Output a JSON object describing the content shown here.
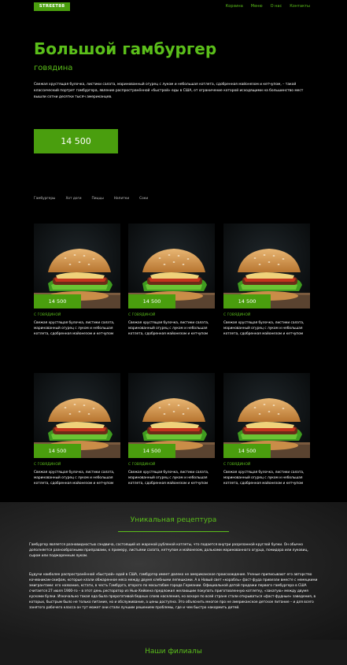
{
  "nav": {
    "logo": "STREET88",
    "links": [
      "Корзина",
      "Меню",
      "О нас",
      "Контакты"
    ]
  },
  "hero": {
    "title": "Большой гамбургер",
    "subtitle": "говядина",
    "description": "Свежая хрустящая булочка, листики салата, маринованный огурец с луком и небольшая котлета, сдобренная майонезом и кетчупом, – такой классический портрет гамбургера, явление распространённой «быстрой» еды в США, от ограничение которой исходящими на большинство мест вышли сотни десятки тысяч американцев.",
    "price": "14 500"
  },
  "tabs": [
    "Гамбургеры",
    "Хот доги",
    "Пиццы",
    "Напитки",
    "Соки"
  ],
  "products": [
    {
      "price": "14 500",
      "category": "С ГОВЯДИНОЙ",
      "text": "Свежая хрустящая булочка, листики салата, маринованный огурец с луком и небольшая котлета, сдобренная майонезом и кетчупом"
    },
    {
      "price": "14 500",
      "category": "С ГОВЯДИНОЙ",
      "text": "Свежая хрустящая булочка, листики салата, маринованный огурец с луком и небольшая котлета, сдобренная майонезом и кетчупом"
    },
    {
      "price": "14 500",
      "category": "С ГОВЯДИНОЙ",
      "text": "Свежая хрустящая булочка, листики салата, маринованный огурец с луком и небольшая котлета, сдобренная майонезом и кетчупом"
    },
    {
      "price": "14 500",
      "category": "С ГОВЯДИНОЙ",
      "text": "Свежая хрустящая булочка, листики салата, маринованный огурец с луком и небольшая котлета, сдобренная майонезом и кетчупом"
    },
    {
      "price": "14 500",
      "category": "С ГОВЯДИНОЙ",
      "text": "Свежая хрустящая булочка, листики салата, маринованный огурец с луком и небольшая котлета, сдобренная майонезом и кетчупом"
    },
    {
      "price": "14 500",
      "category": "С ГОВЯДИНОЙ",
      "text": "Свежая хрустящая булочка, листики салата, маринованный огурец с луком и небольшая котлета, сдобренная майонезом и кетчупом"
    }
  ],
  "recipe": {
    "title": "Уникальная рецептура",
    "p1": "Гамбургер является разновидностью сэндвича, состоящий из жареной рубленой котлеты, что подается внутри разрезанной круглой булки. Он обычно дополняется разнообразными приправами, к примеру, листьями салата, кетчупом и майонезом, дольками маринованного огурца, помидора или луковиц, сыром или поджаренным луком.",
    "p2": "Будучи наиболее распространённой «быстрой» едой в США, гамбургер имеет далеко не американское происхождение. Ученые приписывают его авторство кочевникам-скифам, которые клали обжаренное мясо между двумя хлебными лепешками. А в Новый свет «корабль» фаст-фуда привезли вместе с немецкими эмигрантами: его название, кстати, в честь Гамбурга, второго по масштабам города Германии. Официальной датой продажи первого гамбургера в США считается 27 июля 1900-го – в этот день ресторатор из Нью-Хейвена предложил желающим покупать приготовленную котлетку, «закатую» между двумя кусками булки. Изначально такая еда была прерогативой бедных слоев населения, но вскоре по всей стране стали открываться «фаст-фудные» заведения, в которых, быстрым было не только питание, но и обслуживание, а цены доступна. Это объяснить многое про не американское детское питание – и для всего занятого рабочего класса он тут может они стали лучшим решением проблемы, где и чем быстро накормить детей."
  },
  "branches": {
    "title": "Наши филиалы"
  },
  "colors": {
    "accent": "#5bbf1a",
    "button": "#4a9e0e",
    "background": "#000000"
  }
}
